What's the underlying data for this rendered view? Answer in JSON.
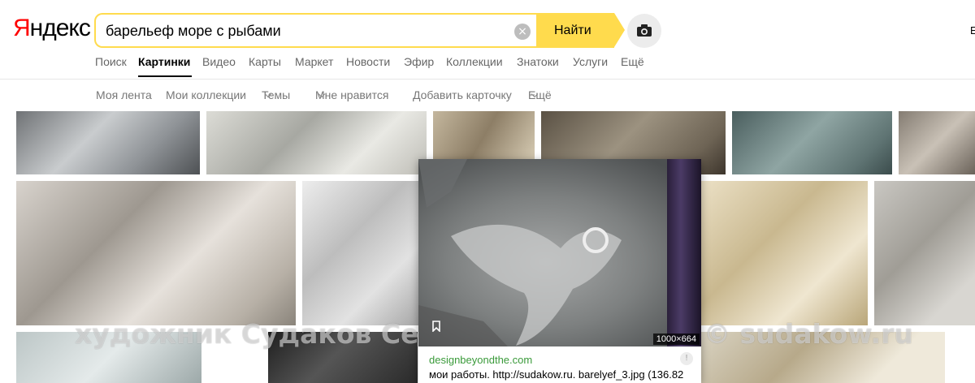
{
  "logo": {
    "first": "Я",
    "rest": "ндекс"
  },
  "search": {
    "query": "барельеф море с рыбами",
    "clear_glyph": "×",
    "find_label": "Найти"
  },
  "camera": {
    "icon": "camera-icon"
  },
  "edge_letter": "Е",
  "services": [
    {
      "label": "Поиск",
      "active": false
    },
    {
      "label": "Картинки",
      "active": true
    },
    {
      "label": "Видео",
      "active": false
    },
    {
      "label": "Карты",
      "active": false
    },
    {
      "label": "Маркет",
      "active": false
    },
    {
      "label": "Новости",
      "active": false
    },
    {
      "label": "Эфир",
      "active": false
    },
    {
      "label": "Коллекции",
      "active": false
    },
    {
      "label": "Знатоки",
      "active": false
    },
    {
      "label": "Услуги",
      "active": false
    },
    {
      "label": "Ещё",
      "active": false
    }
  ],
  "subnav": [
    {
      "label": "Моя лента",
      "dropdown": false
    },
    {
      "label": "Мои коллекции",
      "dropdown": false
    },
    {
      "label": "Темы",
      "dropdown": true
    },
    {
      "label": "Мне нравится",
      "dropdown": true
    },
    {
      "label": "Добавить карточку",
      "dropdown": false
    },
    {
      "label": "Ещё",
      "dropdown": true
    }
  ],
  "preview": {
    "size": "1000×664",
    "domain": "designbeyondthe.com",
    "info_glyph": "!",
    "caption": "мои работы. http://sudakow.ru. barelyef_3.jpg (136.82"
  },
  "watermark": {
    "left": "художник Судаков Сергей",
    "right": "© sudakow.ru"
  },
  "colors": {
    "accent": "#ffdb4d",
    "logo_red": "#ff0000",
    "domain_green": "#3a9a3a"
  }
}
